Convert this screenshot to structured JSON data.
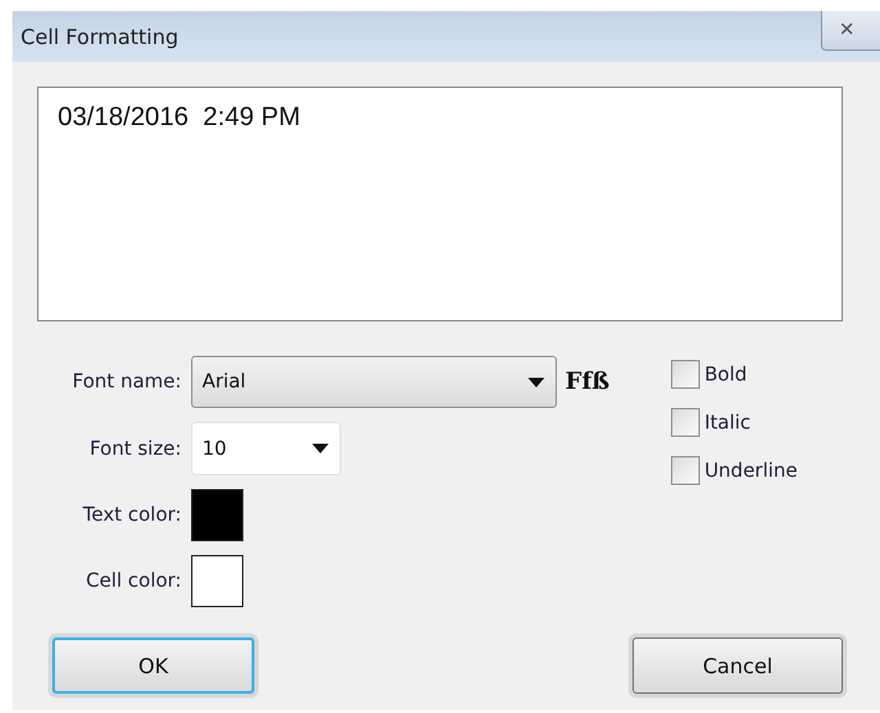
{
  "window": {
    "title": "Cell Formatting",
    "close": "✕"
  },
  "preview": {
    "value": "03/18/2016  2:49 PM"
  },
  "font_name": {
    "label": "Font name:",
    "value": "Arial",
    "sample": "Ffß"
  },
  "font_size": {
    "label": "Font size:",
    "value": "10"
  },
  "text_color": {
    "label": "Text color:",
    "color": "#000000"
  },
  "cell_color": {
    "label": "Cell color:",
    "color": "#ffffff"
  },
  "styles": [
    {
      "label": "Bold",
      "checked": false
    },
    {
      "label": "Italic",
      "checked": false
    },
    {
      "label": "Underline",
      "checked": false
    }
  ],
  "buttons": [
    {
      "label": "OK",
      "default": true
    },
    {
      "label": "Cancel",
      "default": false
    }
  ]
}
